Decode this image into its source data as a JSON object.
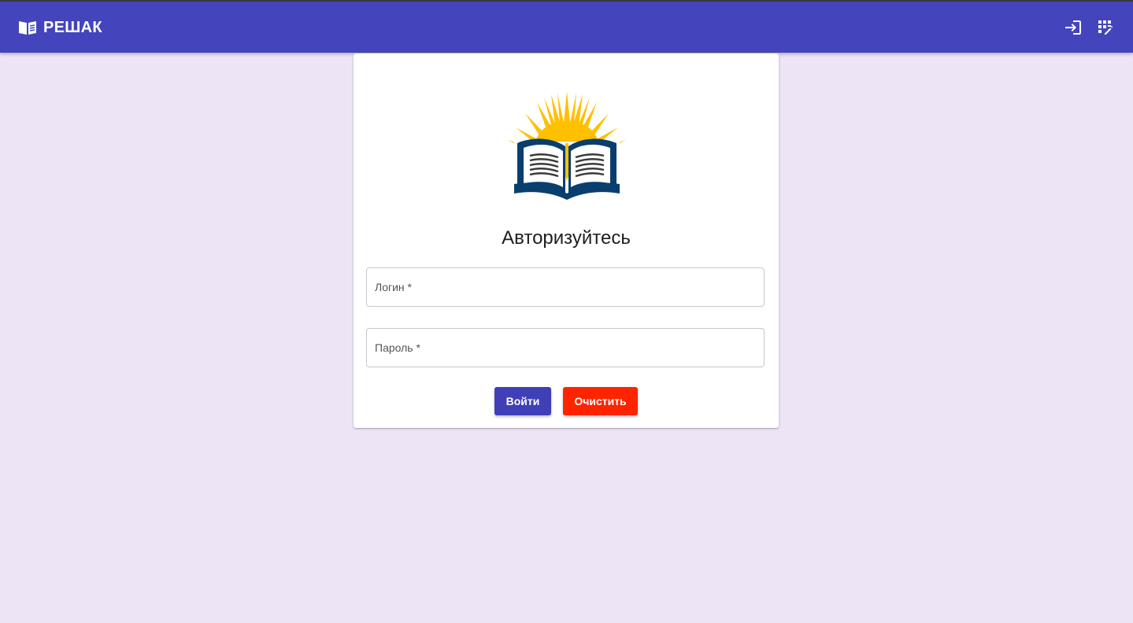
{
  "appbar": {
    "title": "РЕШАК",
    "brand_icon": "open-book-icon",
    "actions": [
      {
        "icon": "login-icon"
      },
      {
        "icon": "edit-grid-icon"
      }
    ],
    "color": "#4444bc"
  },
  "login_card": {
    "logo": "sun-book-logo",
    "heading": "Авторизуйтесь",
    "login_field": {
      "placeholder": "Логин *",
      "value": ""
    },
    "password_field": {
      "placeholder": "Пароль *",
      "value": ""
    },
    "login_button_label": "Войти",
    "clear_button_label": "Очистить"
  },
  "colors": {
    "page_background": "#ede4f6",
    "primary": "#3f3fb7",
    "danger": "#ff2400",
    "logo_sun": "#ffc000",
    "logo_book": "#0a3e6e"
  }
}
